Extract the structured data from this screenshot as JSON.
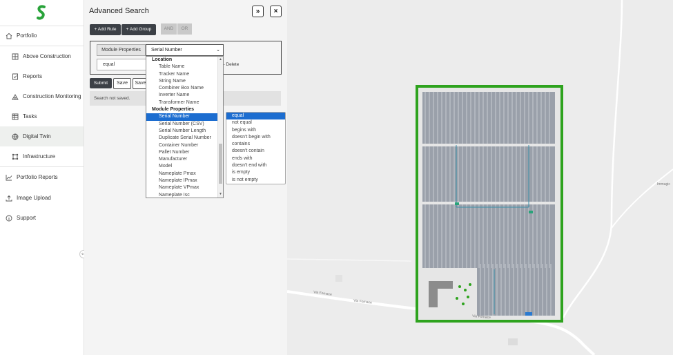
{
  "sidebar": {
    "items": [
      {
        "label": "Portfolio",
        "icon": "home-icon"
      },
      {
        "label": "Above Construction",
        "icon": "grid-icon"
      },
      {
        "label": "Reports",
        "icon": "checklist-icon"
      },
      {
        "label": "Construction Monitoring",
        "icon": "site-icon"
      },
      {
        "label": "Tasks",
        "icon": "table-icon"
      },
      {
        "label": "Digital Twin",
        "icon": "globe-icon",
        "active": true
      },
      {
        "label": "Infrastructure",
        "icon": "nodes-icon"
      },
      {
        "label": "Portfolio Reports",
        "icon": "chart-line-icon"
      },
      {
        "label": "Image Upload",
        "icon": "upload-icon"
      },
      {
        "label": "Support",
        "icon": "info-icon"
      }
    ]
  },
  "panel": {
    "title": "Advanced Search",
    "expand_label": "»",
    "close_label": "×",
    "add_rule_label": "+ Add Rule",
    "add_group_label": "+ Add Group",
    "and_label": "AND",
    "or_label": "OR",
    "property_tag": "Module Properties",
    "field_value": "Serial Number",
    "operator_value": "equal",
    "delete_label": "Delete",
    "submit_label": "Submit",
    "save_label": "Save",
    "save_as_label": "Save",
    "status_text": "Search not saved."
  },
  "field_dropdown": {
    "items": [
      {
        "label": "Location",
        "group": true
      },
      {
        "label": "Table Name"
      },
      {
        "label": "Tracker Name"
      },
      {
        "label": "String Name"
      },
      {
        "label": "Combiner Box Name"
      },
      {
        "label": "Inverter Name"
      },
      {
        "label": "Transformer Name"
      },
      {
        "label": "Module Properties",
        "group": true
      },
      {
        "label": "Serial Number",
        "selected": true
      },
      {
        "label": "Serial Number (CSV)"
      },
      {
        "label": "Serial Number Length"
      },
      {
        "label": "Duplicate Serial Number"
      },
      {
        "label": "Container Number"
      },
      {
        "label": "Pallet Number"
      },
      {
        "label": "Manufacturer"
      },
      {
        "label": "Model"
      },
      {
        "label": "Nameplate Pmax"
      },
      {
        "label": "Nameplate IPmax"
      },
      {
        "label": "Nameplate VPmax"
      },
      {
        "label": "Nameplate Isc"
      }
    ]
  },
  "operator_list": {
    "items": [
      {
        "label": "equal",
        "selected": true
      },
      {
        "label": "not equal"
      },
      {
        "label": "begins with"
      },
      {
        "label": "doesn't begin with"
      },
      {
        "label": "contains"
      },
      {
        "label": "doesn't contain"
      },
      {
        "label": "ends with"
      },
      {
        "label": "doesn't end with"
      },
      {
        "label": "is empty"
      },
      {
        "label": "is not empty"
      }
    ]
  },
  "map": {
    "road_labels": [
      "Via Fornace",
      "Via Fornace",
      "Via Fornace",
      "Immagic"
    ],
    "colors": {
      "background": "#ececec",
      "tree_line": "#2ea31e",
      "panel_fill": "#9aa0aa",
      "road": "#ffffff"
    }
  }
}
